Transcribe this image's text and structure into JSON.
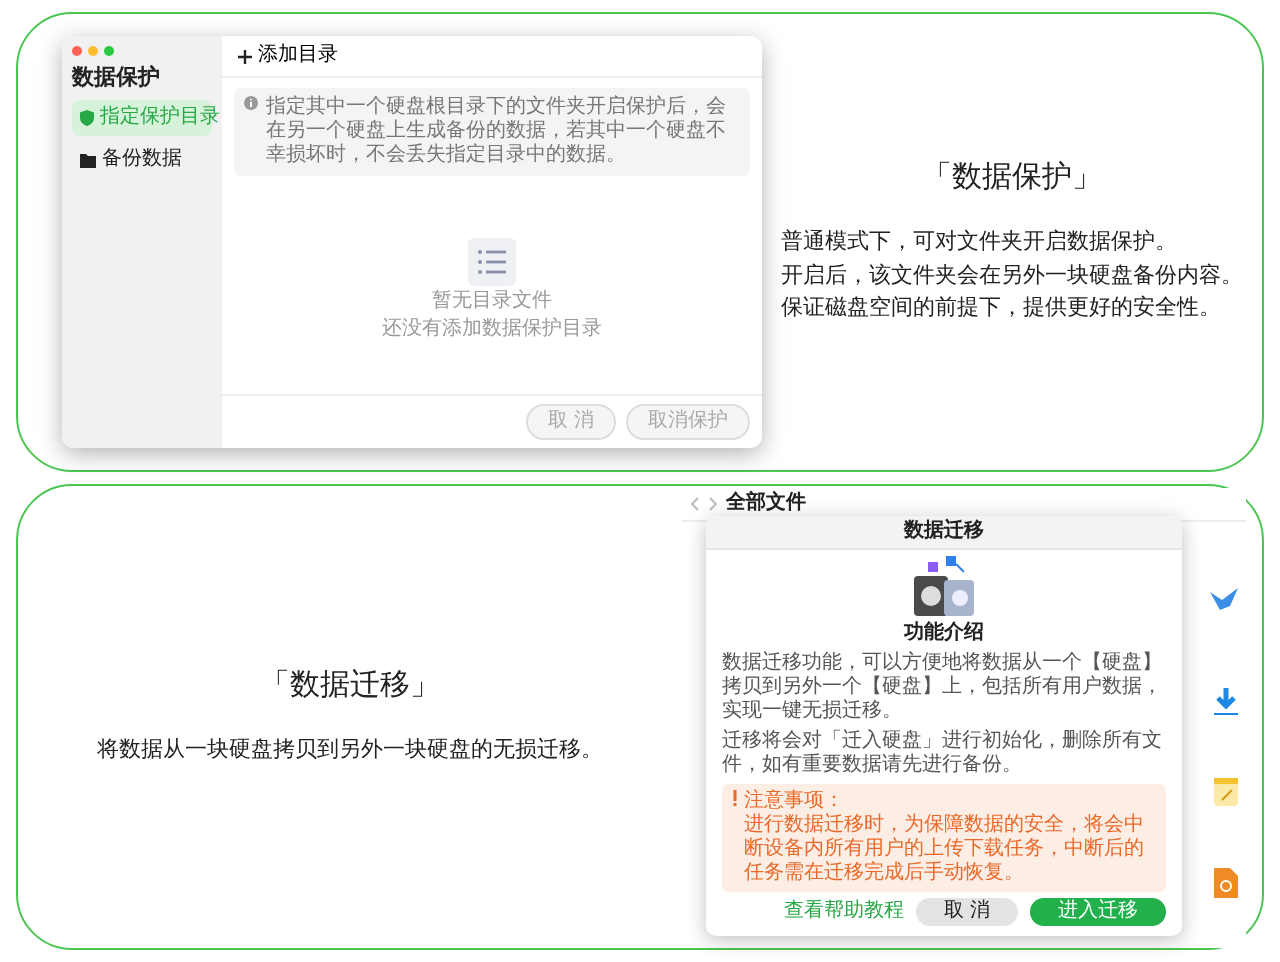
{
  "protect_panel": {
    "window": {
      "title": "数据保护",
      "sidebar": [
        {
          "label": "指定保护目录",
          "kind": "shield",
          "selected": true
        },
        {
          "label": "备份数据",
          "kind": "folder",
          "selected": false
        }
      ],
      "toolbar_button": "添加目录",
      "notice": "指定其中一个硬盘根目录下的文件夹开启保护后，会在另一个硬盘上生成备份的数据，若其中一个硬盘不幸损坏时，不会丢失指定目录中的数据。",
      "empty_title": "暂无目录文件",
      "empty_hint": "还没有添加数据保护目录",
      "buttons": [
        {
          "label": "取 消",
          "disabled": true
        },
        {
          "label": "取消保护",
          "disabled": true
        }
      ]
    },
    "heading": "「数据保护」",
    "description": [
      "普通模式下，可对文件夹开启数据保护。",
      "开启后，该文件夹会在另外一块硬盘备份内容。",
      "保证磁盘空间的前提下，提供更好的安全性。"
    ]
  },
  "migrate_panel": {
    "heading": "「数据迁移」",
    "description": "将数据从一块硬盘拷贝到另外一块硬盘的无损迁移。",
    "file_window": {
      "title": "全部文件"
    },
    "dialog": {
      "title": "数据迁移",
      "section_title": "功能介绍",
      "paragraphs": [
        "数据迁移功能，可以方便地将数据从一个【硬盘】拷贝到另外一个【硬盘】上，包括所有用户数据，实现一键无损迁移。",
        "迁移将会对「迁入硬盘」进行初始化，删除所有文件，如有重要数据请先进行备份。"
      ],
      "warning": {
        "title": "注意事项：",
        "text": "进行数据迁移时，为保障数据的安全，将会中断设备内所有用户的上传下载任务，中断后的任务需在迁移完成后手动恢复。"
      },
      "help_link": "查看帮助教程",
      "buttons": [
        {
          "label": "取 消",
          "kind": "secondary"
        },
        {
          "label": "进入迁移",
          "kind": "primary"
        }
      ]
    }
  }
}
